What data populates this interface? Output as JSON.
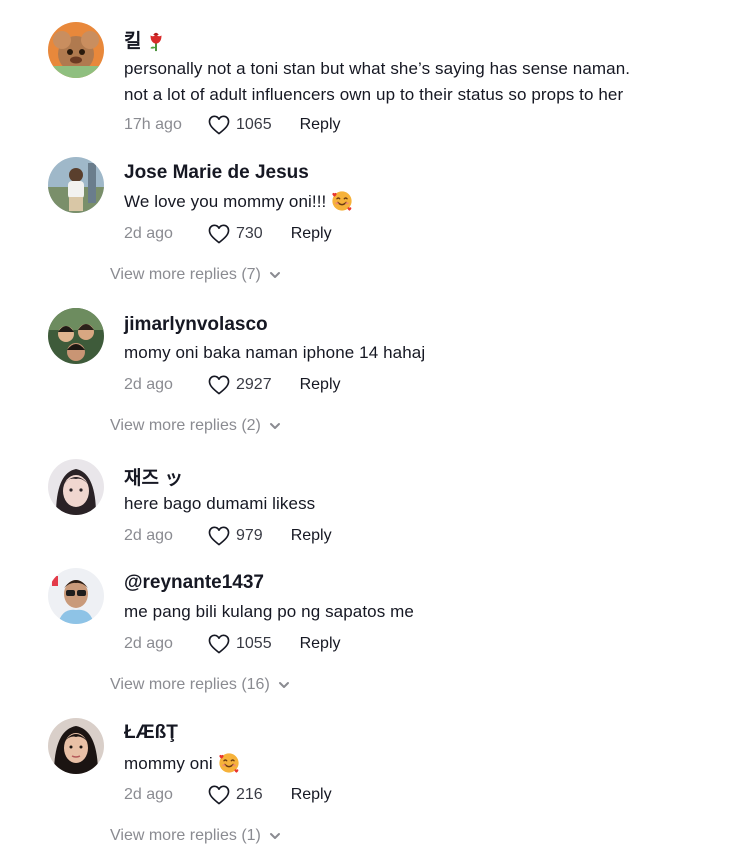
{
  "comments": [
    {
      "username": "킬",
      "username_emoji": "rose-icon",
      "text_lines": [
        "personally not a toni stan but what she’s saying has sense naman.",
        "not a lot of adult influencers own up to their status so props to her"
      ],
      "time": "17h ago",
      "likes": "1065",
      "reply_label": "Reply",
      "more_replies": null
    },
    {
      "username": "Jose Marie de Jesus",
      "text": "We love you mommy oni!!! ",
      "text_emoji": "smiling-face-with-hearts-icon",
      "time": "2d ago",
      "likes": "730",
      "reply_label": "Reply",
      "more_replies": "View more replies (7)"
    },
    {
      "username": "jimarlynvolasco",
      "text": "momy oni baka naman iphone 14 hahaj",
      "time": "2d ago",
      "likes": "2927",
      "reply_label": "Reply",
      "more_replies": "View more replies (2)"
    },
    {
      "username": "재즈 ッ",
      "text": "here bago dumami likess",
      "time": "2d ago",
      "likes": "979",
      "reply_label": "Reply",
      "more_replies": null
    },
    {
      "username": "@reynante1437",
      "text": "me pang bili kulang po ng sapatos me",
      "time": "2d ago",
      "likes": "1055",
      "reply_label": "Reply",
      "more_replies": "View more replies (16)"
    },
    {
      "username": "ŁÆßŢ",
      "text": "mommy oni ",
      "text_emoji": "smiling-face-with-hearts-icon",
      "time": "2d ago",
      "likes": "216",
      "reply_label": "Reply",
      "more_replies": "View more replies (1)"
    }
  ],
  "colors": {
    "primary_text": "#161823",
    "secondary_text": "#8a8b91",
    "background": "#ffffff"
  }
}
